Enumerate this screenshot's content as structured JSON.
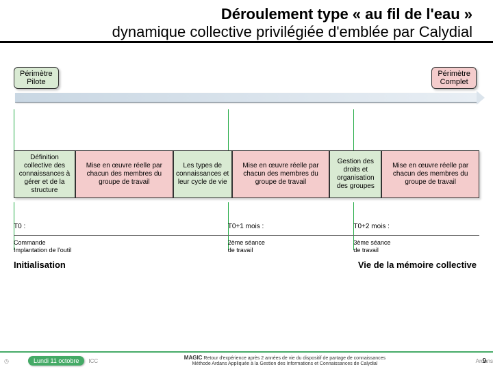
{
  "title": {
    "main": "Déroulement type « au fil de l'eau »",
    "sub": "dynamique collective privilégiée d'emblée par Calydial"
  },
  "scope": {
    "pilot": "Périmètre\nPilote",
    "full": "Périmètre\nComplet"
  },
  "phases": [
    {
      "style": "green w1",
      "text": "Définition collective des connaissances à gérer et de la structure"
    },
    {
      "style": "red w2",
      "text": "Mise en œuvre réelle par chacun des membres du groupe de travail"
    },
    {
      "style": "green w3",
      "text": "Les types de connaissances et leur cycle de vie"
    },
    {
      "style": "red w2",
      "text": "Mise en œuvre réelle par chacun des membres du groupe de travail"
    },
    {
      "style": "green w4",
      "text": "Gestion des droits et organisation des groupes"
    },
    {
      "style": "red w2",
      "text": "Mise en œuvre réelle par chacun des membres du groupe de travail"
    }
  ],
  "timeline": {
    "t0_label": "T0 :",
    "t0_sub": "Commande\nImplantation de l'outil",
    "t1_label": "T0+1 mois :",
    "t1_sub": "2ème séance\nde travail",
    "t2_label": "T0+2 mois :",
    "t2_sub": "3ème séance\nde travail"
  },
  "stages": {
    "left": "Initialisation",
    "right": "Vie de la mémoire collective"
  },
  "footer": {
    "date": "Lundi 11 octobre",
    "mgc": "MAGIC",
    "line1": "Retour d'expérience après 2 années de vie du dispositif de partage de connaissances",
    "line2": "Méthode Ardans Appliquée à la Gestion des Informations et Connaissances de Calydial",
    "page": "9"
  }
}
